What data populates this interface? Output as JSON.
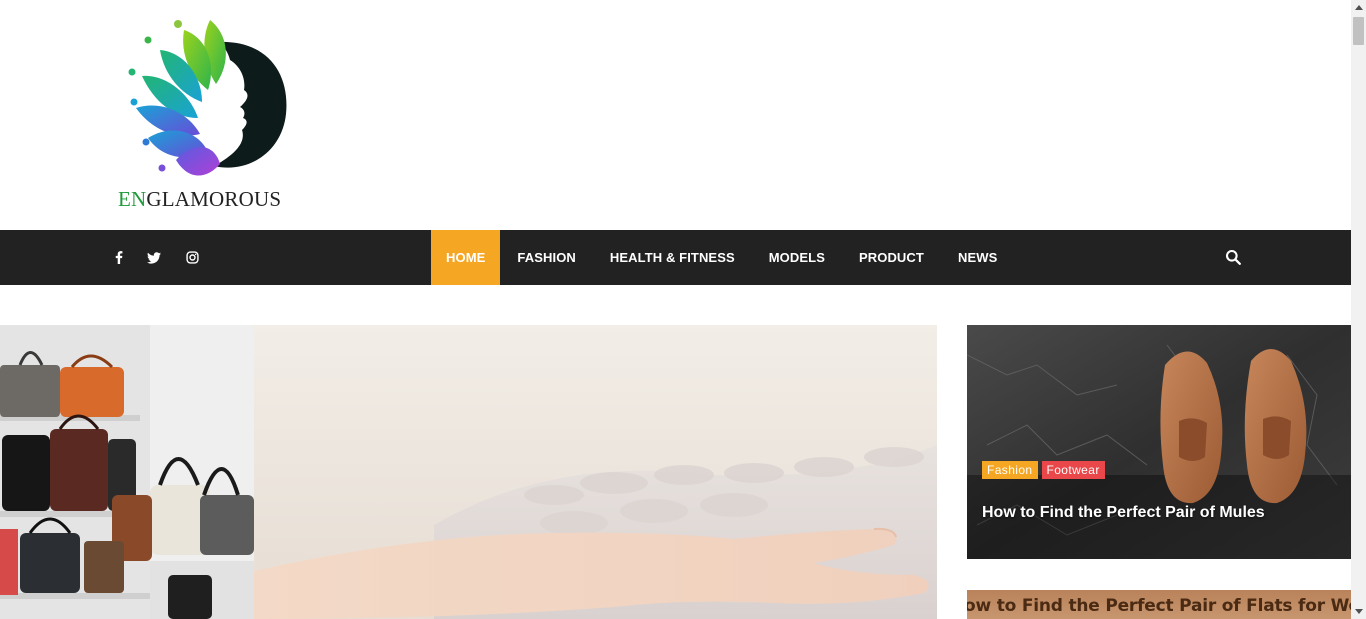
{
  "brand": {
    "logo_prefix": "EN",
    "logo_suffix": "GLAMOROUS",
    "colors": {
      "prefix": "#1f9a3a",
      "suffix": "#222222"
    }
  },
  "nav": {
    "social_icons": [
      "facebook-icon",
      "twitter-icon",
      "instagram-icon"
    ],
    "items": [
      {
        "label": "HOME",
        "active": true
      },
      {
        "label": "FASHION"
      },
      {
        "label": "HEALTH & FITNESS"
      },
      {
        "label": "MODELS"
      },
      {
        "label": "PRODUCT"
      },
      {
        "label": "NEWS"
      }
    ],
    "search_icon": "search-icon",
    "colors": {
      "bar": "#222222",
      "active": "#f5a623"
    }
  },
  "sidebar": {
    "cards": [
      {
        "tags": [
          "Fashion",
          "Footwear"
        ],
        "title": "How to Find the Perfect Pair of Mules"
      },
      {
        "title": "ow to Find the Perfect Pair of Flats for Wome"
      }
    ],
    "tag_colors": {
      "Fashion": "#f5a623",
      "Footwear": "#e9474a"
    }
  }
}
